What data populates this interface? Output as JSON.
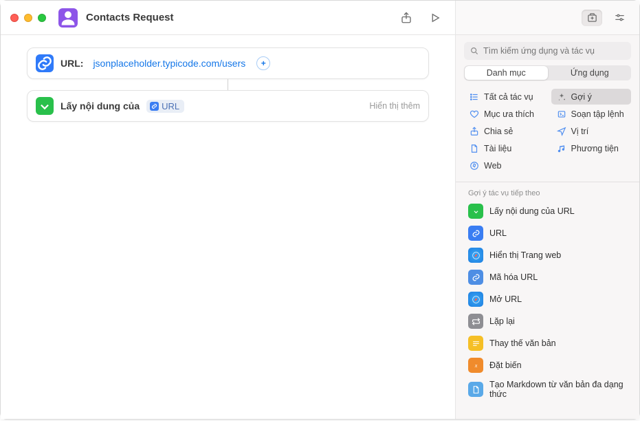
{
  "window": {
    "title": "Contacts Request"
  },
  "canvas": {
    "action1": {
      "label": "URL:",
      "value": "jsonplaceholder.typicode.com/users"
    },
    "action2": {
      "prefix": "Lấy nội dung của",
      "token": "URL",
      "show_more": "Hiển thị thêm"
    }
  },
  "library": {
    "search_placeholder": "Tìm kiếm ứng dụng và tác vụ",
    "seg_a": "Danh mục",
    "seg_b": "Ứng dụng",
    "cats_left": [
      {
        "label": "Tất cả tác vụ",
        "color": "#4f8ef0",
        "icon": "list"
      },
      {
        "label": "Mục ưa thích",
        "color": "#4f8ef0",
        "icon": "heart"
      },
      {
        "label": "Chia sẻ",
        "color": "#4f8ef0",
        "icon": "share"
      },
      {
        "label": "Tài liệu",
        "color": "#4f8ef0",
        "icon": "doc"
      },
      {
        "label": "Web",
        "color": "#4f8ef0",
        "icon": "compass"
      }
    ],
    "cats_right": [
      {
        "label": "Gợi ý",
        "color": "#6d6d6d",
        "icon": "sparkle",
        "selected": true
      },
      {
        "label": "Soạn tập lệnh",
        "color": "#4f8ef0",
        "icon": "script"
      },
      {
        "label": "Vị trí",
        "color": "#4f8ef0",
        "icon": "location"
      },
      {
        "label": "Phương tiện",
        "color": "#4f8ef0",
        "icon": "music"
      }
    ],
    "sug_header": "Gợi ý tác vụ tiếp theo",
    "suggestions": [
      {
        "label": "Lấy nội dung của URL",
        "icon": "download",
        "cls": "green"
      },
      {
        "label": "URL",
        "icon": "link",
        "cls": "blue"
      },
      {
        "label": "Hiển thị Trang web",
        "icon": "safari",
        "cls": "safari"
      },
      {
        "label": "Mã hóa URL",
        "icon": "link",
        "cls": "vblue"
      },
      {
        "label": "Mở URL",
        "icon": "safari",
        "cls": "safari"
      },
      {
        "label": "Lặp lại",
        "icon": "repeat",
        "cls": "gray"
      },
      {
        "label": "Thay thế văn bản",
        "icon": "text",
        "cls": "yellow"
      },
      {
        "label": "Đặt biến",
        "icon": "var",
        "cls": "orange"
      },
      {
        "label": "Tạo Markdown từ văn bản đa dạng thức",
        "icon": "doc",
        "cls": "lblue"
      }
    ]
  }
}
